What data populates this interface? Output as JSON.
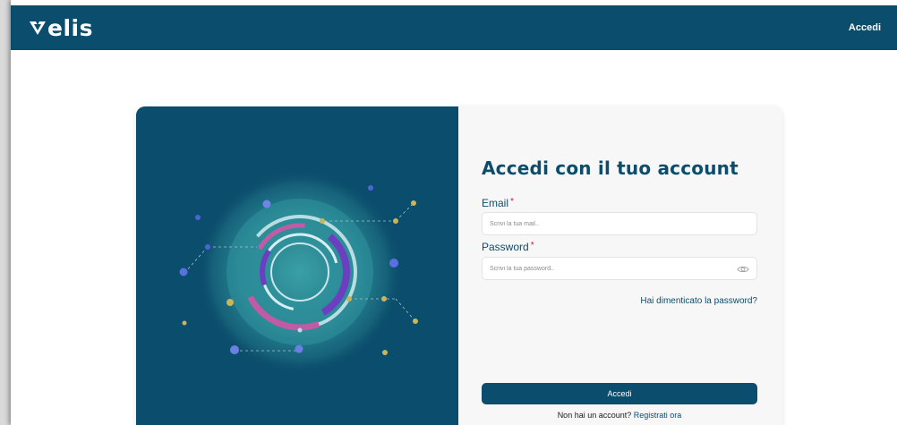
{
  "header": {
    "brand": "elis",
    "login_label": "Accedi",
    "background_color": "#0b4d6c"
  },
  "illustration": {
    "icon": "concentric-rings-network-illustration",
    "colors": {
      "background": "#0b4d6c",
      "glow": "#2c8c99",
      "ring_light": "#b9dde0",
      "ring_pink": "#c15ba6",
      "ring_purple": "#6c3fc1",
      "dot_yellow": "#c9b55a",
      "dot_blue": "#4f63d8"
    }
  },
  "login_form": {
    "title": "Accedi con il tuo account",
    "email": {
      "label": "Email",
      "required_mark": "*",
      "placeholder": "Scrivi la tua mail..",
      "value": ""
    },
    "password": {
      "label": "Password",
      "required_mark": "*",
      "placeholder": "Scrivi la tua password..",
      "value": "",
      "toggle_icon": "eye-icon"
    },
    "forgot_password": "Hai dimenticato la password?",
    "submit_label": "Accedi",
    "signup_prompt": "Non hai un account?",
    "signup_link": "Registrati ora"
  }
}
